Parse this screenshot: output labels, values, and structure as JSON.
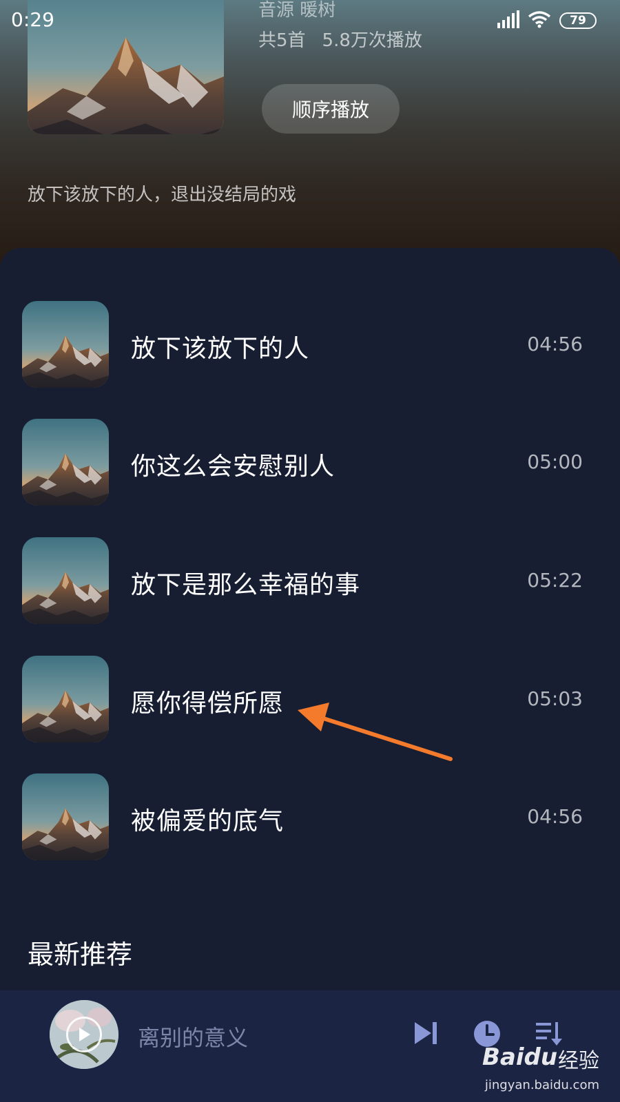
{
  "status_bar": {
    "time": "0:29",
    "battery": "79"
  },
  "album": {
    "source": "音源 暖树",
    "song_count": "共5首",
    "play_count": "5.8万次播放",
    "play_order_label": "顺序播放",
    "description": "放下该放下的人，退出没结局的戏"
  },
  "songs": [
    {
      "title": "放下该放下的人",
      "duration": "04:56"
    },
    {
      "title": "你这么会安慰别人",
      "duration": "05:00"
    },
    {
      "title": "放下是那么幸福的事",
      "duration": "05:22"
    },
    {
      "title": "愿你得偿所愿",
      "duration": "05:03"
    },
    {
      "title": "被偏爱的底气",
      "duration": "04:56"
    }
  ],
  "section": {
    "title": "最新推荐"
  },
  "mini_player": {
    "title": "离别的意义",
    "controls": [
      "next-track-icon",
      "clock-icon",
      "playlist-icon"
    ]
  },
  "watermark": {
    "brand": "Baidu",
    "sub": "经验",
    "url": "jingyan.baidu.com"
  },
  "colors": {
    "background": "#171e32",
    "mini_player_bg": "#1c2444",
    "annotation_arrow": "#f47a2c"
  }
}
